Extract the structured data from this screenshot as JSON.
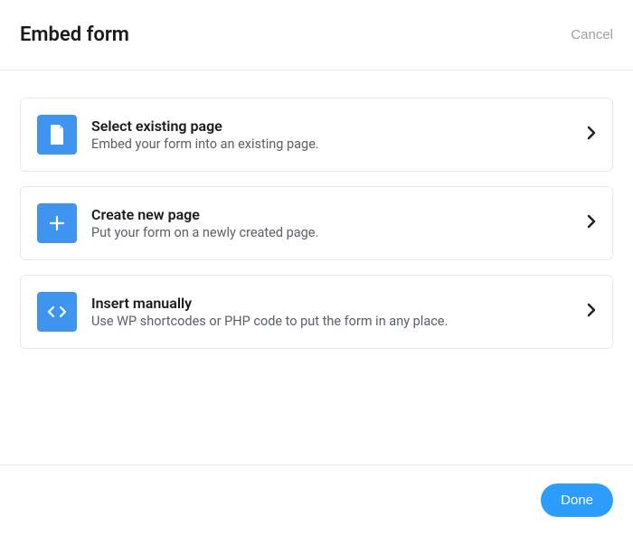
{
  "header": {
    "title": "Embed form",
    "cancel_label": "Cancel"
  },
  "options": [
    {
      "icon": "page-icon",
      "title": "Select existing page",
      "description": "Embed your form into an existing page."
    },
    {
      "icon": "plus-icon",
      "title": "Create new page",
      "description": "Put your form on a newly created page."
    },
    {
      "icon": "code-icon",
      "title": "Insert manually",
      "description": "Use WP shortcodes or PHP code to put the form in any place."
    }
  ],
  "footer": {
    "done_label": "Done"
  },
  "colors": {
    "accent": "#3f94ef",
    "primary_button": "#2c9dfd"
  }
}
